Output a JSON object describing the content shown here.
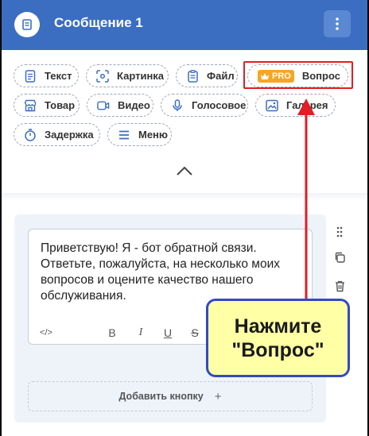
{
  "header": {
    "title": "Сообщение 1"
  },
  "blocks": [
    {
      "label": "Текст",
      "icon": "text-doc-icon"
    },
    {
      "label": "Картинка",
      "icon": "image-scan-icon"
    },
    {
      "label": "Файл",
      "icon": "file-icon"
    },
    {
      "label": "Вопрос",
      "icon": "crown-icon",
      "badge": "PRO"
    },
    {
      "label": "Товар",
      "icon": "store-icon"
    },
    {
      "label": "Видео",
      "icon": "video-icon"
    },
    {
      "label": "Голосовое",
      "icon": "microphone-icon"
    },
    {
      "label": "Галерея",
      "icon": "gallery-icon"
    },
    {
      "label": "Задержка",
      "icon": "timer-icon"
    },
    {
      "label": "Меню",
      "icon": "menu-icon"
    }
  ],
  "editor": {
    "message": "Приветствую! Я - бот обратной связи. Ответьте, пожалуйста, на несколько моих вопросов и оцените качество нашего обслуживания.",
    "toolbar": {
      "code": "</>",
      "bold": "B",
      "italic": "I",
      "underline": "U",
      "strike": "S"
    }
  },
  "add_button": {
    "label": "Добавить кнопку",
    "plus": "+"
  },
  "callout": {
    "line1": "Нажмите",
    "line2": "\"Вопрос\""
  },
  "colors": {
    "header": "#3b6ec1",
    "badge": "#f6a623",
    "highlight": "#e11d25",
    "callout_bg": "#ffffa6",
    "callout_border": "#3349c6"
  }
}
